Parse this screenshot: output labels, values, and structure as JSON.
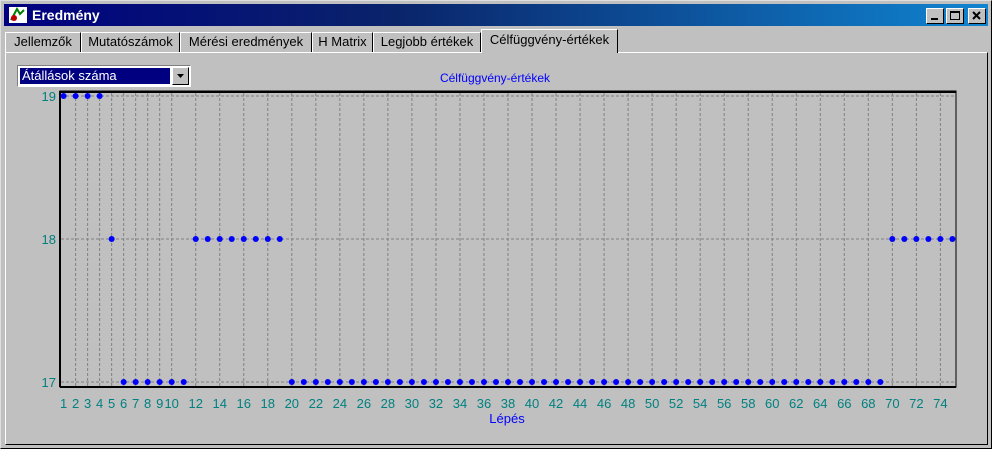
{
  "window": {
    "title": "Eredmény"
  },
  "tabs": [
    {
      "label": "Jellemzők"
    },
    {
      "label": "Mutatószámok"
    },
    {
      "label": "Mérési eredmények"
    },
    {
      "label": "H Matrix"
    },
    {
      "label": "Legjobb értékek"
    },
    {
      "label": "Célfüggvény-értékek",
      "active": true
    }
  ],
  "dropdown": {
    "value": "Átállások száma"
  },
  "icons": {
    "app": "app-icon",
    "minimize": "minimize-icon",
    "maximize": "maximize-icon",
    "close": "close-icon",
    "dropdown": "chevron-down-icon"
  },
  "colors": {
    "title_gradient_start": "#000080",
    "title_gradient_end": "#1084d0",
    "point": "#0000ff",
    "tick_label": "#008080",
    "axis_title": "#0000ff"
  },
  "chart_data": {
    "type": "scatter",
    "title": "Célfüggvény-értékek",
    "xlabel": "Lépés",
    "ylabel": "",
    "xlim": [
      1,
      75
    ],
    "ylim": [
      17,
      19
    ],
    "y_ticks": [
      17,
      18,
      19
    ],
    "x_ticks": [
      1,
      2,
      3,
      4,
      5,
      6,
      7,
      8,
      9,
      10,
      12,
      14,
      16,
      18,
      20,
      22,
      24,
      26,
      28,
      30,
      32,
      34,
      36,
      38,
      40,
      42,
      44,
      46,
      48,
      50,
      52,
      54,
      56,
      58,
      60,
      62,
      64,
      66,
      68,
      70,
      72,
      74
    ],
    "grid": true,
    "x": [
      1,
      2,
      3,
      4,
      5,
      6,
      7,
      8,
      9,
      10,
      11,
      12,
      13,
      14,
      15,
      16,
      17,
      18,
      19,
      20,
      21,
      22,
      23,
      24,
      25,
      26,
      27,
      28,
      29,
      30,
      31,
      32,
      33,
      34,
      35,
      36,
      37,
      38,
      39,
      40,
      41,
      42,
      43,
      44,
      45,
      46,
      47,
      48,
      49,
      50,
      51,
      52,
      53,
      54,
      55,
      56,
      57,
      58,
      59,
      60,
      61,
      62,
      63,
      64,
      65,
      66,
      67,
      68,
      69,
      70,
      71,
      72,
      73,
      74,
      75
    ],
    "y": [
      19,
      19,
      19,
      19,
      18,
      17,
      17,
      17,
      17,
      17,
      17,
      18,
      18,
      18,
      18,
      18,
      18,
      18,
      18,
      17,
      17,
      17,
      17,
      17,
      17,
      17,
      17,
      17,
      17,
      17,
      17,
      17,
      17,
      17,
      17,
      17,
      17,
      17,
      17,
      17,
      17,
      17,
      17,
      17,
      17,
      17,
      17,
      17,
      17,
      17,
      17,
      17,
      17,
      17,
      17,
      17,
      17,
      17,
      17,
      17,
      17,
      17,
      17,
      17,
      17,
      17,
      17,
      17,
      17,
      18,
      18,
      18,
      18,
      18,
      18
    ]
  }
}
